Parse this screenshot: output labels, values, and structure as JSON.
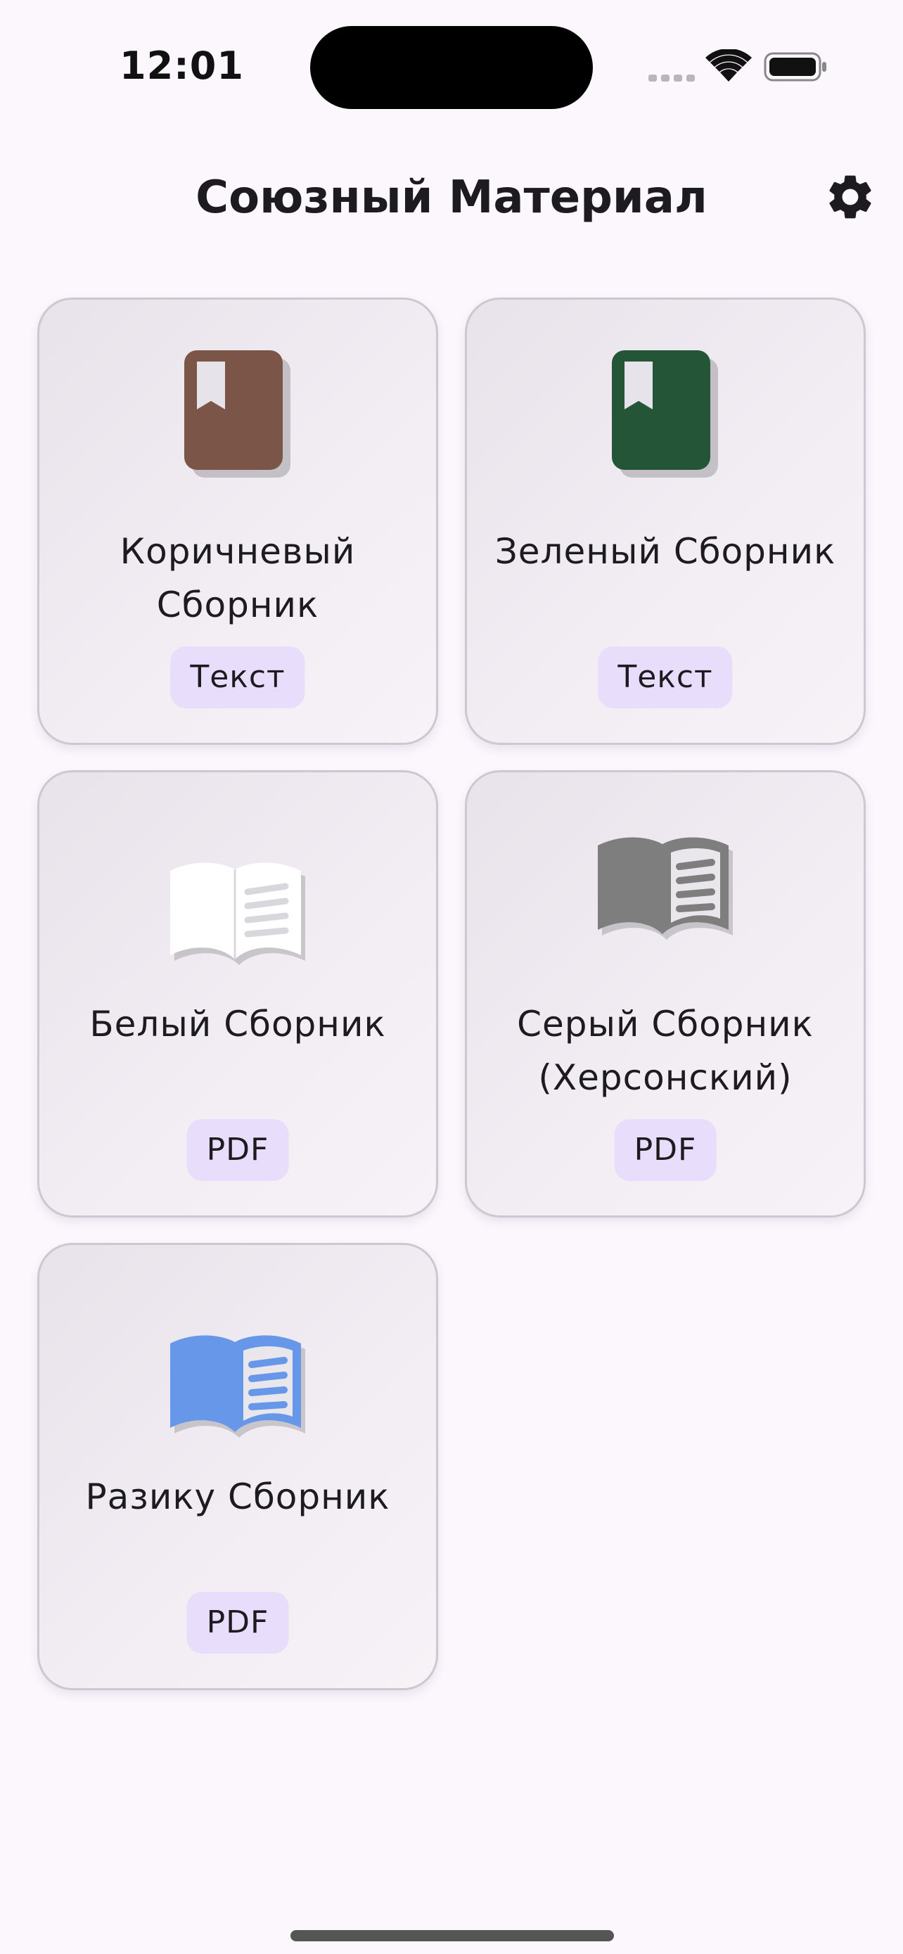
{
  "status_bar": {
    "time": "12:01"
  },
  "header": {
    "title": "Союзный Материал",
    "settings_icon": "gear-icon"
  },
  "collections": [
    {
      "title": "Коричневый Сборник",
      "badge": "Текст",
      "icon": "bookmark-book-icon",
      "color": "#7a5548"
    },
    {
      "title": "Зеленый Сборник",
      "badge": "Текст",
      "icon": "bookmark-book-icon",
      "color": "#245536"
    },
    {
      "title": "Белый Сборник",
      "badge": "PDF",
      "icon": "open-book-icon",
      "color": "#ffffff"
    },
    {
      "title": "Серый Сборник (Херсонский)",
      "badge": "PDF",
      "icon": "open-book-icon",
      "color": "#7e7e7e"
    },
    {
      "title": "Разику Сборник",
      "badge": "PDF",
      "icon": "open-book-icon",
      "color": "#6797e9"
    }
  ],
  "colors": {
    "background": "#fcf7fd",
    "badge_background": "#e8ddfb",
    "card_border": "#cdc7d1"
  }
}
